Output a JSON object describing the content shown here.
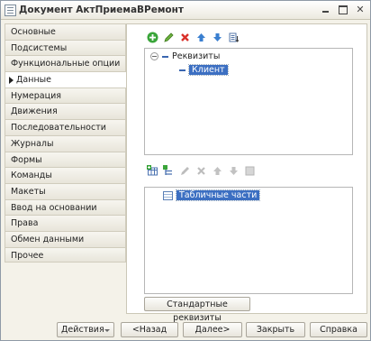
{
  "window": {
    "title": "Документ АктПриемаВРемонт"
  },
  "nav": {
    "items": [
      {
        "label": "Основные"
      },
      {
        "label": "Подсистемы"
      },
      {
        "label": "Функциональные опции"
      },
      {
        "label": "Данные",
        "active": true
      },
      {
        "label": "Нумерация"
      },
      {
        "label": "Движения"
      },
      {
        "label": "Последовательности"
      },
      {
        "label": "Журналы"
      },
      {
        "label": "Формы"
      },
      {
        "label": "Команды"
      },
      {
        "label": "Макеты"
      },
      {
        "label": "Ввод на основании"
      },
      {
        "label": "Права"
      },
      {
        "label": "Обмен данными"
      },
      {
        "label": "Прочее"
      }
    ]
  },
  "attributes": {
    "toolbar_icons": [
      "add-icon",
      "edit-icon",
      "delete-icon",
      "move-up-icon",
      "move-down-icon",
      "sort-icon"
    ],
    "root_label": "Реквизиты",
    "items": [
      {
        "label": "Клиент",
        "selected": true
      }
    ]
  },
  "tabular": {
    "toolbar_icons": [
      "add-table-icon",
      "add-column-icon",
      "edit-icon",
      "delete-icon",
      "move-up-icon",
      "move-down-icon",
      "sort-icon"
    ],
    "root_label": "Табличные части"
  },
  "standard_attrs_label": "Стандартные реквизиты",
  "footer": {
    "actions": "Действия",
    "back": "<Назад",
    "next": "Далее>",
    "close": "Закрыть",
    "help": "Справка"
  }
}
